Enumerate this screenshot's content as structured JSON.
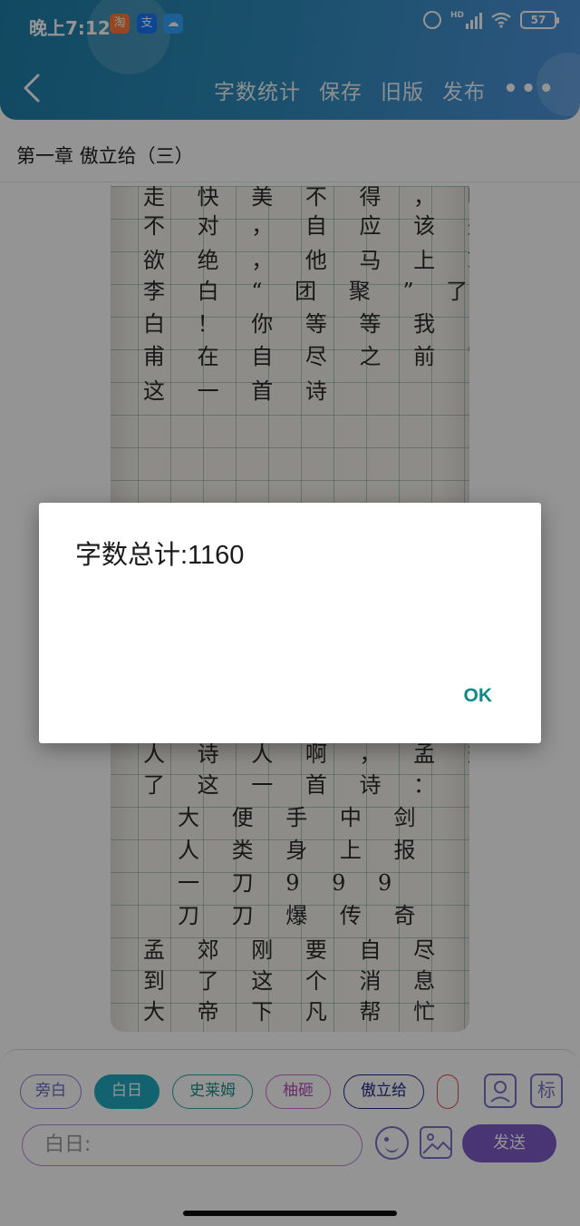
{
  "status_bar": {
    "time": "晚上7:12",
    "app_icons": [
      "taobao-icon",
      "alipay-icon",
      "cloud-icon"
    ],
    "network_label": "HD",
    "battery_level": "57"
  },
  "header": {
    "back_icon": "chevron-left-icon",
    "actions": [
      "字数统计",
      "保存",
      "旧版",
      "发布"
    ],
    "more_icon": "more-dots-icon",
    "more_symbol": "•••"
  },
  "chapter": {
    "title": "第一章 傲立给（三）"
  },
  "manuscript": {
    "top_lines": [
      "走 快 美 不 得 ， 呃",
      "不 对 ， 自 应 该 是 悲 痛",
      "欲 绝 ， 他 马 上 就 要 和",
      "李 白 “ 团 聚 ” 了 ： 李",
      "白 ！ 你 等 等 我 ！ 杜",
      "甫 在 自 尽 之 前 写 好 的",
      "这 一 首 诗"
    ],
    "bottom_lines": [
      "人 诗 人 啊 ， 孟 郊 写 好",
      "了 这 一 首 诗 ：",
      "大 便 手 中 剑",
      "人 类 身 上 报",
      "一 刀 9 9 9",
      "刀 刀 爆 传 奇",
      "孟 郊 刚 要 自 尽 ， 可 听",
      "到 了 这 个 消 息 ， 玉 皇",
      "大 帝 下 凡 帮 忙 了 ！ ！"
    ]
  },
  "chat": {
    "roles": [
      "旁白",
      "白日",
      "史莱姆",
      "柚砸",
      "傲立给",
      ""
    ],
    "selected_role": "白日",
    "input_value": "白日:",
    "tag_icon_label": "标",
    "send_label": "发送"
  },
  "dialog": {
    "message": "字数总计:1160",
    "ok_label": "OK"
  },
  "colors": {
    "header_start": "#1f7fa9",
    "header_end": "#4f94dc",
    "accent_purple": "#7e5bc9",
    "selected_chip": "#1fa9c1",
    "dialog_button": "#0f8a86"
  }
}
